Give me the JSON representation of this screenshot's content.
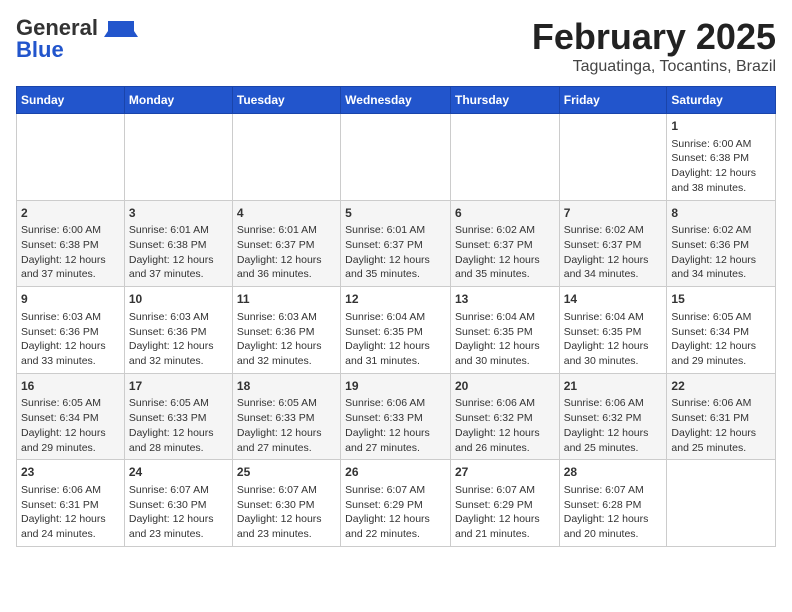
{
  "header": {
    "logo_general": "General",
    "logo_blue": "Blue",
    "title": "February 2025",
    "subtitle": "Taguatinga, Tocantins, Brazil"
  },
  "days_of_week": [
    "Sunday",
    "Monday",
    "Tuesday",
    "Wednesday",
    "Thursday",
    "Friday",
    "Saturday"
  ],
  "weeks": [
    [
      {
        "day": "",
        "info": ""
      },
      {
        "day": "",
        "info": ""
      },
      {
        "day": "",
        "info": ""
      },
      {
        "day": "",
        "info": ""
      },
      {
        "day": "",
        "info": ""
      },
      {
        "day": "",
        "info": ""
      },
      {
        "day": "1",
        "info": "Sunrise: 6:00 AM\nSunset: 6:38 PM\nDaylight: 12 hours and 38 minutes."
      }
    ],
    [
      {
        "day": "2",
        "info": "Sunrise: 6:00 AM\nSunset: 6:38 PM\nDaylight: 12 hours and 37 minutes."
      },
      {
        "day": "3",
        "info": "Sunrise: 6:01 AM\nSunset: 6:38 PM\nDaylight: 12 hours and 37 minutes."
      },
      {
        "day": "4",
        "info": "Sunrise: 6:01 AM\nSunset: 6:37 PM\nDaylight: 12 hours and 36 minutes."
      },
      {
        "day": "5",
        "info": "Sunrise: 6:01 AM\nSunset: 6:37 PM\nDaylight: 12 hours and 35 minutes."
      },
      {
        "day": "6",
        "info": "Sunrise: 6:02 AM\nSunset: 6:37 PM\nDaylight: 12 hours and 35 minutes."
      },
      {
        "day": "7",
        "info": "Sunrise: 6:02 AM\nSunset: 6:37 PM\nDaylight: 12 hours and 34 minutes."
      },
      {
        "day": "8",
        "info": "Sunrise: 6:02 AM\nSunset: 6:36 PM\nDaylight: 12 hours and 34 minutes."
      }
    ],
    [
      {
        "day": "9",
        "info": "Sunrise: 6:03 AM\nSunset: 6:36 PM\nDaylight: 12 hours and 33 minutes."
      },
      {
        "day": "10",
        "info": "Sunrise: 6:03 AM\nSunset: 6:36 PM\nDaylight: 12 hours and 32 minutes."
      },
      {
        "day": "11",
        "info": "Sunrise: 6:03 AM\nSunset: 6:36 PM\nDaylight: 12 hours and 32 minutes."
      },
      {
        "day": "12",
        "info": "Sunrise: 6:04 AM\nSunset: 6:35 PM\nDaylight: 12 hours and 31 minutes."
      },
      {
        "day": "13",
        "info": "Sunrise: 6:04 AM\nSunset: 6:35 PM\nDaylight: 12 hours and 30 minutes."
      },
      {
        "day": "14",
        "info": "Sunrise: 6:04 AM\nSunset: 6:35 PM\nDaylight: 12 hours and 30 minutes."
      },
      {
        "day": "15",
        "info": "Sunrise: 6:05 AM\nSunset: 6:34 PM\nDaylight: 12 hours and 29 minutes."
      }
    ],
    [
      {
        "day": "16",
        "info": "Sunrise: 6:05 AM\nSunset: 6:34 PM\nDaylight: 12 hours and 29 minutes."
      },
      {
        "day": "17",
        "info": "Sunrise: 6:05 AM\nSunset: 6:33 PM\nDaylight: 12 hours and 28 minutes."
      },
      {
        "day": "18",
        "info": "Sunrise: 6:05 AM\nSunset: 6:33 PM\nDaylight: 12 hours and 27 minutes."
      },
      {
        "day": "19",
        "info": "Sunrise: 6:06 AM\nSunset: 6:33 PM\nDaylight: 12 hours and 27 minutes."
      },
      {
        "day": "20",
        "info": "Sunrise: 6:06 AM\nSunset: 6:32 PM\nDaylight: 12 hours and 26 minutes."
      },
      {
        "day": "21",
        "info": "Sunrise: 6:06 AM\nSunset: 6:32 PM\nDaylight: 12 hours and 25 minutes."
      },
      {
        "day": "22",
        "info": "Sunrise: 6:06 AM\nSunset: 6:31 PM\nDaylight: 12 hours and 25 minutes."
      }
    ],
    [
      {
        "day": "23",
        "info": "Sunrise: 6:06 AM\nSunset: 6:31 PM\nDaylight: 12 hours and 24 minutes."
      },
      {
        "day": "24",
        "info": "Sunrise: 6:07 AM\nSunset: 6:30 PM\nDaylight: 12 hours and 23 minutes."
      },
      {
        "day": "25",
        "info": "Sunrise: 6:07 AM\nSunset: 6:30 PM\nDaylight: 12 hours and 23 minutes."
      },
      {
        "day": "26",
        "info": "Sunrise: 6:07 AM\nSunset: 6:29 PM\nDaylight: 12 hours and 22 minutes."
      },
      {
        "day": "27",
        "info": "Sunrise: 6:07 AM\nSunset: 6:29 PM\nDaylight: 12 hours and 21 minutes."
      },
      {
        "day": "28",
        "info": "Sunrise: 6:07 AM\nSunset: 6:28 PM\nDaylight: 12 hours and 20 minutes."
      },
      {
        "day": "",
        "info": ""
      }
    ]
  ]
}
